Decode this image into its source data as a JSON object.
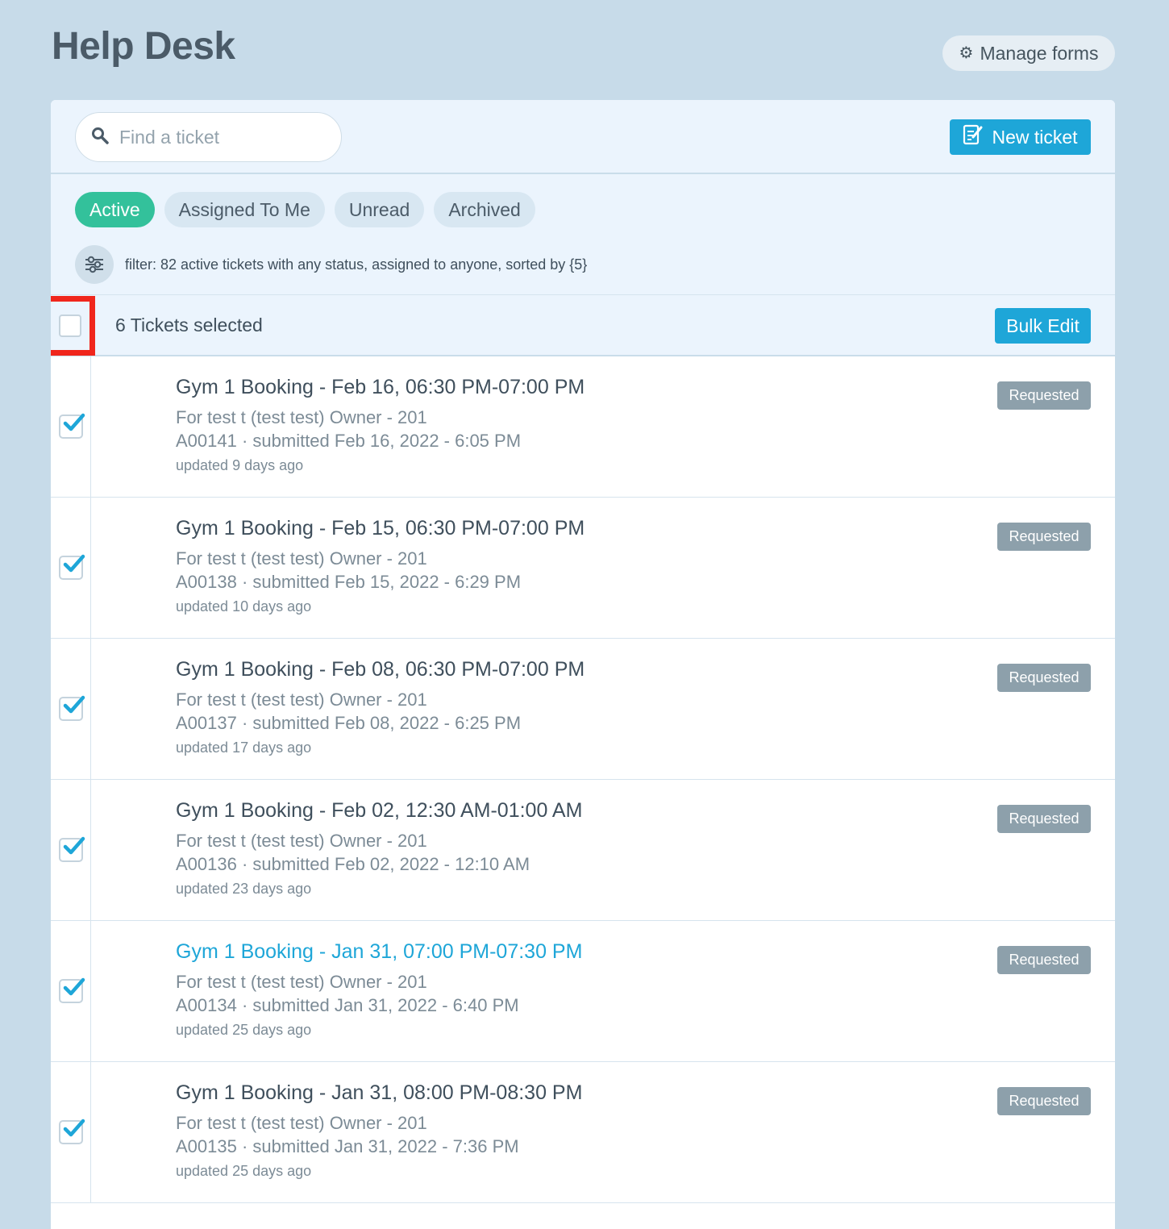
{
  "header": {
    "title": "Help Desk",
    "manage_forms_label": "Manage forms"
  },
  "toolbar": {
    "search_placeholder": "Find a ticket",
    "new_ticket_label": "New ticket"
  },
  "tabs": [
    {
      "label": "Active",
      "active": true
    },
    {
      "label": "Assigned To Me",
      "active": false
    },
    {
      "label": "Unread",
      "active": false
    },
    {
      "label": "Archived",
      "active": false
    }
  ],
  "filter_text": "filter: 82 active tickets with any status, assigned to anyone, sorted by {5}",
  "selection": {
    "count_label": "6 Tickets selected",
    "bulk_edit_label": "Bulk Edit"
  },
  "tickets": [
    {
      "title": "Gym 1 Booking - Feb 16, 06:30 PM-07:00 PM",
      "for": "For test t (test test) Owner - 201",
      "submitted": "A00141 · submitted Feb 16, 2022 - 6:05 PM",
      "updated": "updated 9 days ago",
      "status": "Requested"
    },
    {
      "title": "Gym 1 Booking - Feb 15, 06:30 PM-07:00 PM",
      "for": "For test t (test test) Owner - 201",
      "submitted": "A00138 · submitted Feb 15, 2022 - 6:29 PM",
      "updated": "updated 10 days ago",
      "status": "Requested"
    },
    {
      "title": "Gym 1 Booking - Feb 08, 06:30 PM-07:00 PM",
      "for": "For test t (test test) Owner - 201",
      "submitted": "A00137 · submitted Feb 08, 2022 - 6:25 PM",
      "updated": "updated 17 days ago",
      "status": "Requested"
    },
    {
      "title": "Gym 1 Booking - Feb 02, 12:30 AM-01:00 AM",
      "for": "For test t (test test) Owner - 201",
      "submitted": "A00136 · submitted Feb 02, 2022 - 12:10 AM",
      "updated": "updated 23 days ago",
      "status": "Requested"
    },
    {
      "title": "Gym 1 Booking - Jan 31, 07:00 PM-07:30 PM",
      "for": "For test t (test test) Owner - 201",
      "submitted": "A00134 · submitted Jan 31, 2022 - 6:40 PM",
      "updated": "updated 25 days ago",
      "status": "Requested"
    },
    {
      "title": "Gym 1 Booking - Jan 31, 08:00 PM-08:30 PM",
      "for": "For test t (test test) Owner - 201",
      "submitted": "A00135 · submitted Jan 31, 2022 - 7:36 PM",
      "updated": "updated 25 days ago",
      "status": "Requested"
    }
  ],
  "colors": {
    "accent": "#1ea6d8",
    "active_tab": "#33c19b",
    "status_badge": "#8da0ab",
    "highlight": "#f0261c"
  }
}
